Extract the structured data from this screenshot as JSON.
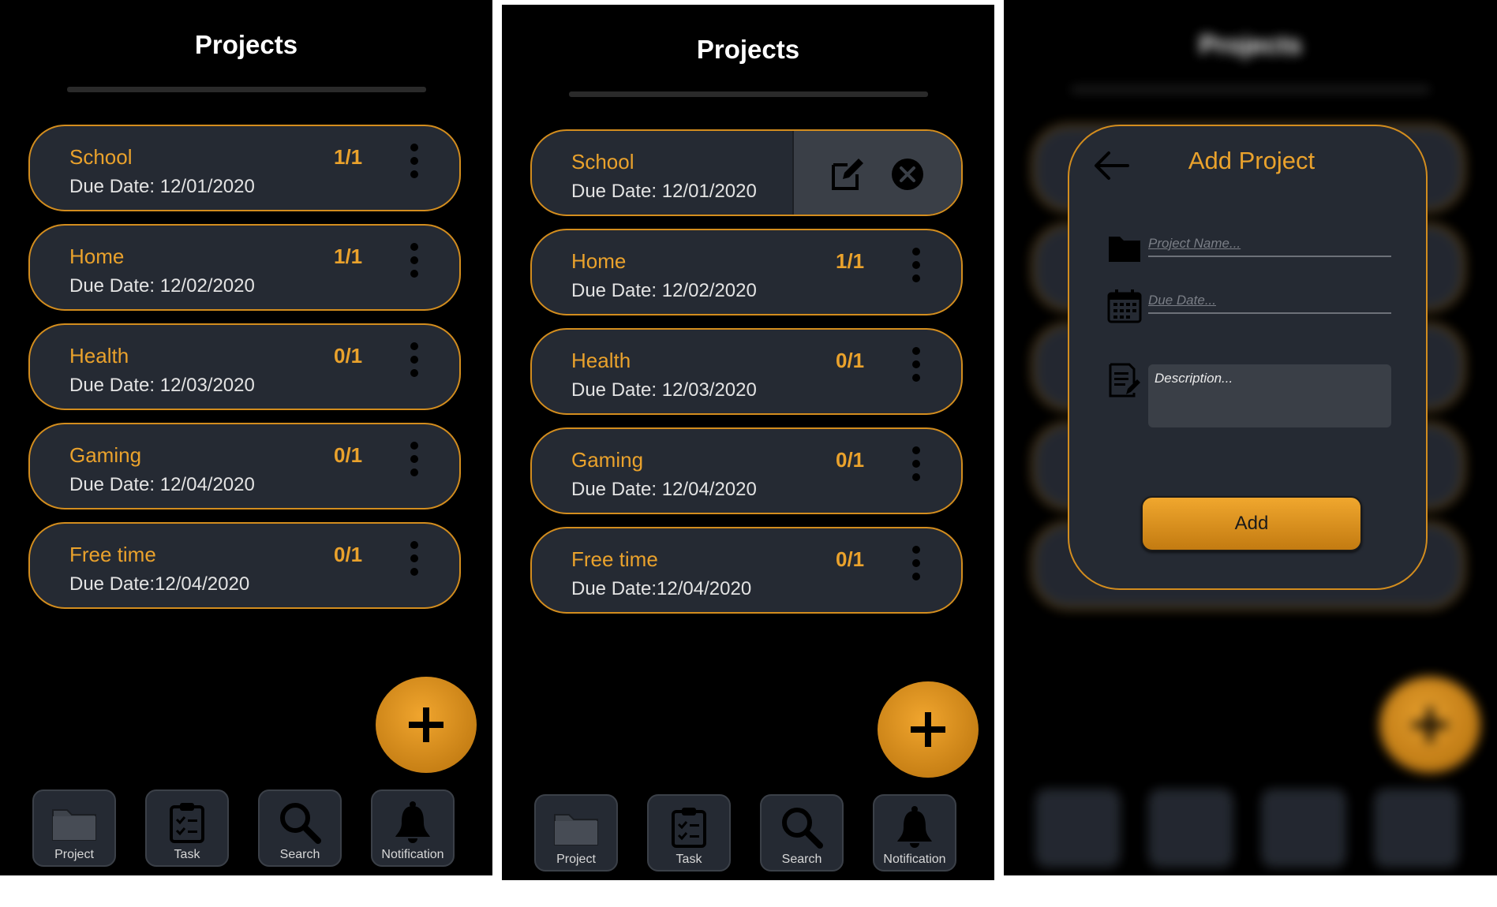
{
  "header": {
    "title": "Projects"
  },
  "projects": [
    {
      "name": "School",
      "due": "Due Date: 12/01/2020",
      "count": "1/1"
    },
    {
      "name": "Home",
      "due": "Due Date: 12/02/2020",
      "count": "1/1"
    },
    {
      "name": "Health",
      "due": "Due Date: 12/03/2020",
      "count": "0/1"
    },
    {
      "name": "Gaming",
      "due": "Due Date: 12/04/2020",
      "count": "0/1"
    },
    {
      "name": "Free time",
      "due": "Due Date:12/04/2020",
      "count": "0/1"
    }
  ],
  "swipe_actions": {
    "edit_icon": "edit-icon",
    "delete_icon": "close-circle-icon"
  },
  "fab": {
    "icon": "plus-icon"
  },
  "nav": [
    {
      "label": "Project",
      "icon": "folder-icon"
    },
    {
      "label": "Task",
      "icon": "clipboard-icon"
    },
    {
      "label": "Search",
      "icon": "search-icon"
    },
    {
      "label": "Notification",
      "icon": "bell-icon"
    }
  ],
  "modal": {
    "title": "Add Project",
    "project_name_placeholder": "Project Name...",
    "due_date_placeholder": "Due Date...",
    "description_placeholder": "Description...",
    "add_label": "Add"
  },
  "colors": {
    "accent": "#eaa22c",
    "card_bg": "#252a33",
    "border": "#d38d1e",
    "background": "#000000"
  }
}
